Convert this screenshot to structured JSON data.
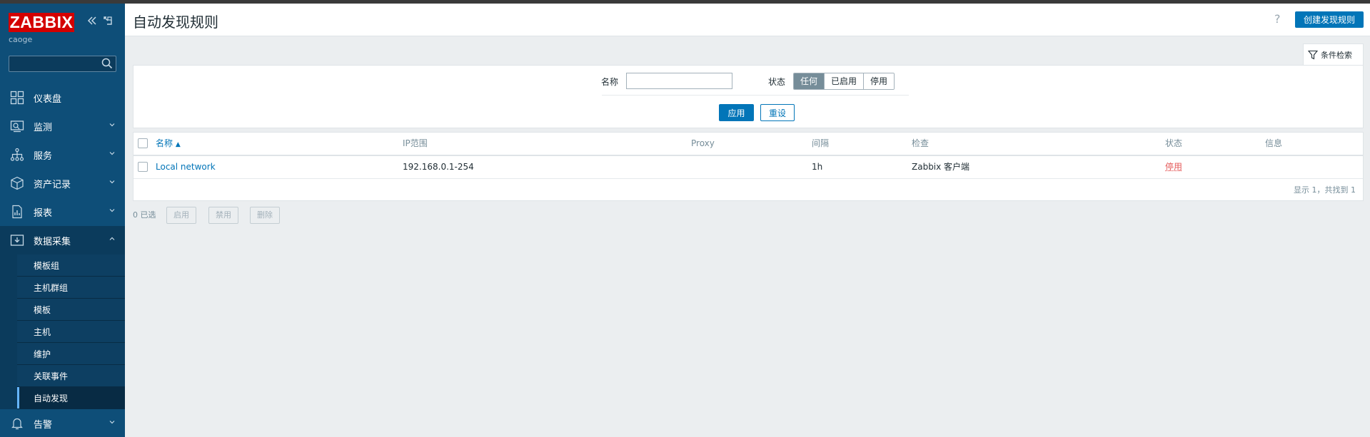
{
  "app": {
    "logo": "ZABBIX",
    "username": "caoge"
  },
  "sidebar": {
    "search_placeholder": "",
    "items": [
      {
        "label": "仪表盘",
        "icon": "dashboard-icon"
      },
      {
        "label": "监测",
        "icon": "monitoring-icon"
      },
      {
        "label": "服务",
        "icon": "services-icon"
      },
      {
        "label": "资产记录",
        "icon": "inventory-icon"
      },
      {
        "label": "报表",
        "icon": "reports-icon"
      },
      {
        "label": "数据采集",
        "icon": "data-collection-icon"
      },
      {
        "label": "告警",
        "icon": "alerts-icon"
      }
    ],
    "submenu": [
      "模板组",
      "主机群组",
      "模板",
      "主机",
      "维护",
      "关联事件",
      "自动发现"
    ],
    "active_submenu": "自动发现"
  },
  "header": {
    "title": "自动发现规则",
    "help": "?",
    "create_button": "创建发现规则"
  },
  "filter": {
    "tab_label": "条件检索",
    "name_label": "名称",
    "name_value": "",
    "status_label": "状态",
    "status_options": [
      "任何",
      "已启用",
      "停用"
    ],
    "status_selected": "任何",
    "apply": "应用",
    "reset": "重设"
  },
  "table": {
    "columns": [
      "名称",
      "IP范围",
      "Proxy",
      "间隔",
      "检查",
      "状态",
      "信息"
    ],
    "sort_column": "名称",
    "rows": [
      {
        "name": "Local network",
        "ip_range": "192.168.0.1-254",
        "proxy": "",
        "interval": "1h",
        "checks": "Zabbix 客户端",
        "status": "停用",
        "info": ""
      }
    ],
    "footer": "显示 1，共找到 1"
  },
  "bulk": {
    "selected": "0 已选",
    "enable": "启用",
    "disable": "禁用",
    "delete": "删除"
  },
  "colors": {
    "sidebar": "#0e4e78",
    "accent": "#0275b8",
    "status_disabled": "#e45959",
    "logo": "#d40000"
  }
}
